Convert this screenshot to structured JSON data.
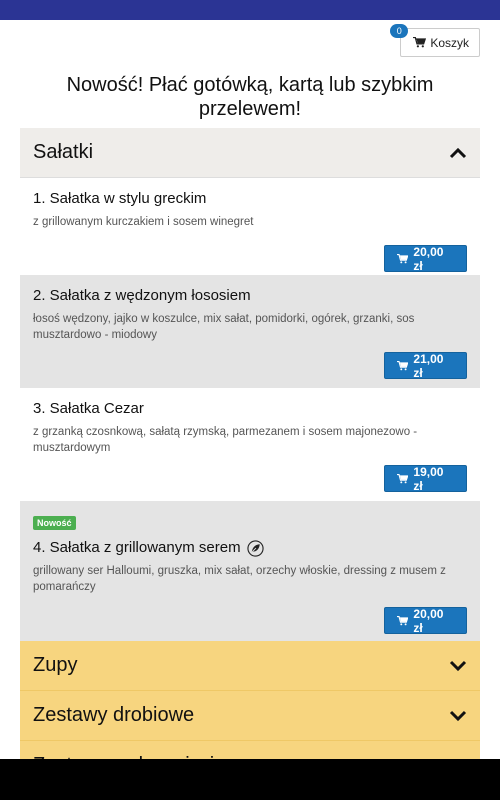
{
  "cart": {
    "count": "0",
    "label": "Koszyk",
    "icon": "cart-icon"
  },
  "headline": "Nowość! Płać gotówką, kartą lub szybkim przelewem!",
  "colors": {
    "topbar": "#2b3494",
    "accent": "#1b75bc",
    "category_closed": "#f7d57f",
    "category_open": "#efedea",
    "badge_new": "#4caf50"
  },
  "categories": [
    {
      "name": "Sałatki",
      "expanded": true,
      "items": [
        {
          "title": "1. Sałatka w stylu greckim",
          "description": "z grillowanym kurczakiem i sosem winegret",
          "price": "20,00 zł"
        },
        {
          "title": "2. Sałatka z wędzonym łososiem",
          "description": "łosoś wędzony, jajko w koszulce, mix sałat, pomidorki, ogórek, grzanki, sos musztardowo - miodowy",
          "price": "21,00 zł"
        },
        {
          "title": "3. Sałatka Cezar",
          "description": "z grzanką czosnkową, sałatą rzymską, parmezanem i sosem majonezowo - musztardowym",
          "price": "19,00 zł"
        },
        {
          "badge": "Nowość",
          "title": "4. Sałatka z grillowanym serem",
          "description": "grillowany ser Halloumi, gruszka, mix sałat, orzechy włoskie, dressing z musem z pomarańczy",
          "price": "20,00 zł",
          "icon": "leaf-icon"
        }
      ]
    },
    {
      "name": "Zupy",
      "expanded": false
    },
    {
      "name": "Zestawy drobiowe",
      "expanded": false
    },
    {
      "name": "Zestawy wołowe i wieprzowe",
      "expanded": false
    }
  ]
}
